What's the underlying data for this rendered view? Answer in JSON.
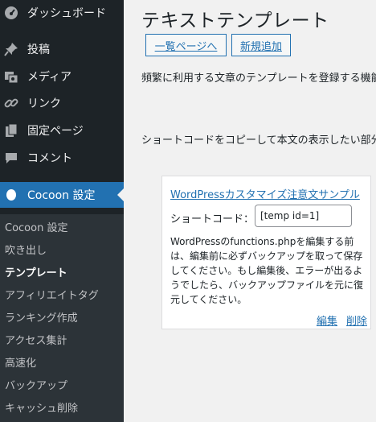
{
  "sidebar": {
    "items": [
      {
        "label": "ダッシュボード",
        "icon": "dashboard-icon"
      },
      {
        "label": "投稿",
        "icon": "pin-icon"
      },
      {
        "label": "メディア",
        "icon": "media-icon"
      },
      {
        "label": "リンク",
        "icon": "link-icon"
      },
      {
        "label": "固定ページ",
        "icon": "page-icon"
      },
      {
        "label": "コメント",
        "icon": "comment-icon"
      },
      {
        "label": "Cocoon 設定",
        "icon": "cocoon-icon"
      }
    ],
    "submenu": [
      "Cocoon 設定",
      "吹き出し",
      "テンプレート",
      "アフィリエイトタグ",
      "ランキング作成",
      "アクセス集計",
      "高速化",
      "バックアップ",
      "キャッシュ削除"
    ],
    "active_submenu": "テンプレート",
    "colors": {
      "bg": "#1d2327",
      "submenu_bg": "#2c3338",
      "current": "#2271b1"
    }
  },
  "main": {
    "title": "テキストテンプレート",
    "buttons": {
      "list_label": "一覧ページへ",
      "new_label": "新規追加"
    },
    "description": "頻繁に利用する文章のテンプレートを登録する機能",
    "instruction": "ショートコードをコピーして本文の表示したい部分",
    "card": {
      "title": "WordPressカスタマイズ注意文サンプル",
      "shortcode_label": "ショートコード：",
      "shortcode_value": "[temp id=1]",
      "body": "WordPressのfunctions.phpを編集する前は、編集前に必ずバックアップを取って保存してください。もし編集後、エラーが出るようでしたら、バックアップファイルを元に復元してください。",
      "edit_label": "編集",
      "delete_label": "削除"
    },
    "colors": {
      "link": "#2271b1",
      "text": "#1d2327",
      "bg": "#f1f1f1"
    }
  }
}
